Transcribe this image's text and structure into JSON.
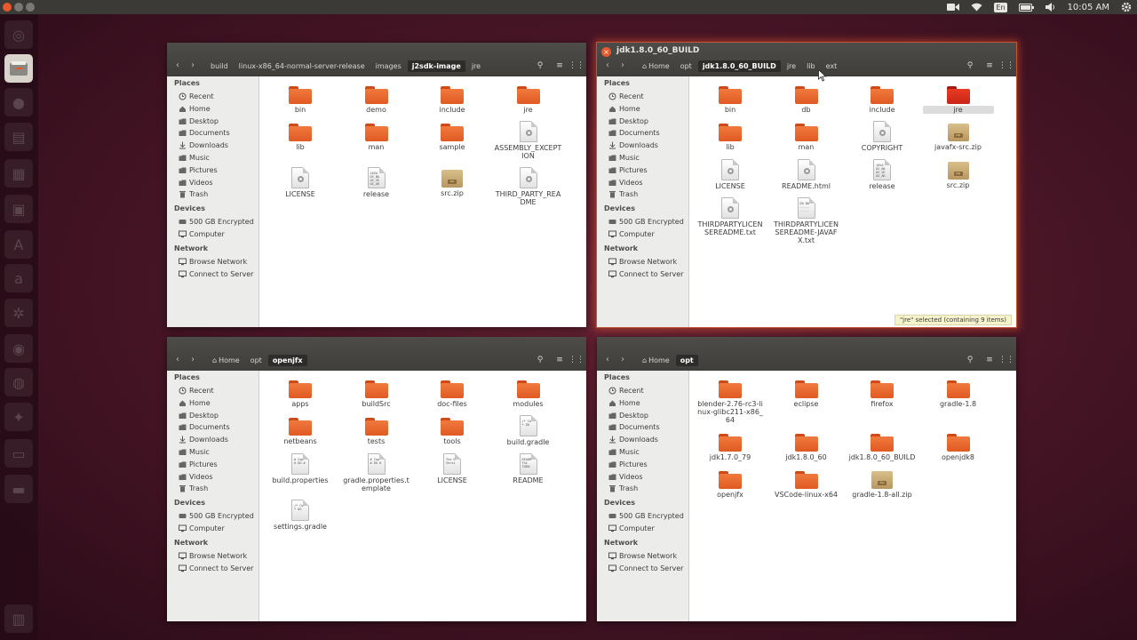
{
  "top_panel": {
    "keyboard_layout": "En",
    "time": "10:05 AM"
  },
  "colors": {
    "accent": "#e8572c",
    "folder": "#f07a3e",
    "selected_folder": "#e02a1a",
    "panel": "#3b3a36"
  },
  "sidebar": {
    "places_heading": "Places",
    "places": [
      {
        "label": "Recent",
        "icon": "clock-icon"
      },
      {
        "label": "Home",
        "icon": "home-icon"
      },
      {
        "label": "Desktop",
        "icon": "desktop-icon"
      },
      {
        "label": "Documents",
        "icon": "documents-icon"
      },
      {
        "label": "Downloads",
        "icon": "downloads-icon"
      },
      {
        "label": "Music",
        "icon": "music-icon"
      },
      {
        "label": "Pictures",
        "icon": "pictures-icon"
      },
      {
        "label": "Videos",
        "icon": "videos-icon"
      },
      {
        "label": "Trash",
        "icon": "trash-icon"
      }
    ],
    "devices_heading": "Devices",
    "devices": [
      {
        "label": "500 GB Encrypted",
        "icon": "drive-icon"
      },
      {
        "label": "Computer",
        "icon": "computer-icon"
      }
    ],
    "network_heading": "Network",
    "network": [
      {
        "label": "Browse Network",
        "icon": "network-icon"
      },
      {
        "label": "Connect to Server",
        "icon": "server-icon"
      }
    ]
  },
  "windows": [
    {
      "title": "",
      "breadcrumb": [
        {
          "label": "build",
          "current": false
        },
        {
          "label": "linux-x86_64-normal-server-release",
          "current": false
        },
        {
          "label": "images",
          "current": false
        },
        {
          "label": "j2sdk-image",
          "current": true
        },
        {
          "label": "jre",
          "current": false
        }
      ],
      "files": [
        {
          "name": "bin",
          "type": "folder"
        },
        {
          "name": "demo",
          "type": "folder"
        },
        {
          "name": "include",
          "type": "folder"
        },
        {
          "name": "jre",
          "type": "folder"
        },
        {
          "name": "lib",
          "type": "folder"
        },
        {
          "name": "man",
          "type": "folder"
        },
        {
          "name": "sample",
          "type": "folder"
        },
        {
          "name": "ASSEMBLY_EXCEPTION",
          "type": "doc"
        },
        {
          "name": "LICENSE",
          "type": "doc"
        },
        {
          "name": "release",
          "type": "text",
          "preview": "JAVA OS_NA OS_VE OS_AR"
        },
        {
          "name": "src.zip",
          "type": "zip"
        },
        {
          "name": "THIRD_PARTY_README",
          "type": "doc"
        }
      ]
    },
    {
      "title": "jdk1.8.0_60_BUILD",
      "breadcrumb": [
        {
          "label": "Home",
          "current": false,
          "home": true
        },
        {
          "label": "opt",
          "current": false
        },
        {
          "label": "jdk1.8.0_60_BUILD",
          "current": true
        },
        {
          "label": "jre",
          "current": false
        },
        {
          "label": "lib",
          "current": false
        },
        {
          "label": "ext",
          "current": false
        }
      ],
      "files": [
        {
          "name": "bin",
          "type": "folder"
        },
        {
          "name": "db",
          "type": "folder"
        },
        {
          "name": "include",
          "type": "folder"
        },
        {
          "name": "jre",
          "type": "folder",
          "selected": true
        },
        {
          "name": "lib",
          "type": "folder"
        },
        {
          "name": "man",
          "type": "folder"
        },
        {
          "name": "COPYRIGHT",
          "type": "doc"
        },
        {
          "name": "javafx-src.zip",
          "type": "zip"
        },
        {
          "name": "LICENSE",
          "type": "doc"
        },
        {
          "name": "README.html",
          "type": "doc"
        },
        {
          "name": "release",
          "type": "text",
          "preview": "JAVA OS_NA OS_VE OS_AR"
        },
        {
          "name": "src.zip",
          "type": "zip"
        },
        {
          "name": "THIRDPARTYLICENSEREADME.txt",
          "type": "doc"
        },
        {
          "name": "THIRDPARTYLICENSEREADME-JAVAFX.txt",
          "type": "text",
          "preview": "DO NO ----- -----"
        }
      ],
      "status": "\"jre\" selected  (containing 9 items)"
    },
    {
      "title": "",
      "breadcrumb": [
        {
          "label": "Home",
          "current": false,
          "home": true
        },
        {
          "label": "opt",
          "current": false
        },
        {
          "label": "openjfx",
          "current": true
        }
      ],
      "files": [
        {
          "name": "apps",
          "type": "folder"
        },
        {
          "name": "buildSrc",
          "type": "folder"
        },
        {
          "name": "doc-files",
          "type": "folder"
        },
        {
          "name": "modules",
          "type": "folder"
        },
        {
          "name": "netbeans",
          "type": "folder"
        },
        {
          "name": "tests",
          "type": "folder"
        },
        {
          "name": "tools",
          "type": "folder"
        },
        {
          "name": "build.gradle",
          "type": "text",
          "preview": "/* Co * DO"
        },
        {
          "name": "build.properties",
          "type": "text",
          "preview": "# Cop # DO #"
        },
        {
          "name": "gradle.properties.template",
          "type": "text",
          "preview": "# Cop # DO #"
        },
        {
          "name": "LICENSE",
          "type": "text",
          "preview": "The G Versi"
        },
        {
          "name": "README",
          "type": "text",
          "preview": "READM Thi TODO:"
        },
        {
          "name": "settings.gradle",
          "type": "text",
          "preview": "/* Co * DO"
        }
      ]
    },
    {
      "title": "",
      "breadcrumb": [
        {
          "label": "Home",
          "current": false,
          "home": true
        },
        {
          "label": "opt",
          "current": true
        }
      ],
      "files": [
        {
          "name": "blender-2.76-rc3-linux-glibc211-x86_64",
          "type": "folder"
        },
        {
          "name": "eclipse",
          "type": "folder"
        },
        {
          "name": "firefox",
          "type": "folder"
        },
        {
          "name": "gradle-1.8",
          "type": "folder"
        },
        {
          "name": "jdk1.7.0_79",
          "type": "folder"
        },
        {
          "name": "jdk1.8.0_60",
          "type": "folder"
        },
        {
          "name": "jdk1.8.0_60_BUILD",
          "type": "folder"
        },
        {
          "name": "openjdk8",
          "type": "folder"
        },
        {
          "name": "openjfx",
          "type": "folder"
        },
        {
          "name": "VSCode-linux-x64",
          "type": "folder"
        },
        {
          "name": "gradle-1.8-all.zip",
          "type": "zip"
        }
      ]
    }
  ]
}
